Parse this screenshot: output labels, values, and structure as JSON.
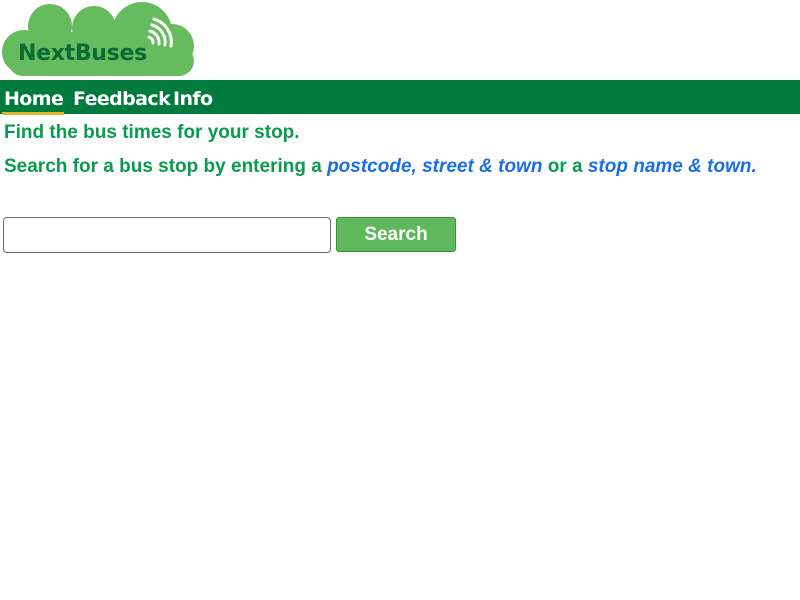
{
  "logo": {
    "text": "NextBuses",
    "colors": {
      "cloud": "#66bb5f",
      "text": "#0a6b34",
      "signal": "#ffffff"
    }
  },
  "nav": {
    "items": [
      {
        "label": "Home",
        "active": true
      },
      {
        "label": "Feedback",
        "active": false
      },
      {
        "label": "Info",
        "active": false
      }
    ],
    "colors": {
      "bar": "#007a3d",
      "active_underline": "#e6b42a"
    }
  },
  "main": {
    "intro": "Find the bus times for your stop.",
    "instructions": {
      "part1": "Search for a bus stop by entering a ",
      "highlight1": "postcode, street & town",
      "part2": " or a ",
      "highlight2": "stop name & town."
    },
    "search": {
      "value": "",
      "placeholder": "",
      "button_label": "Search"
    },
    "colors": {
      "text": "#0a9a50",
      "highlight": "#1b6fe0",
      "button": "#5fb85c"
    }
  }
}
